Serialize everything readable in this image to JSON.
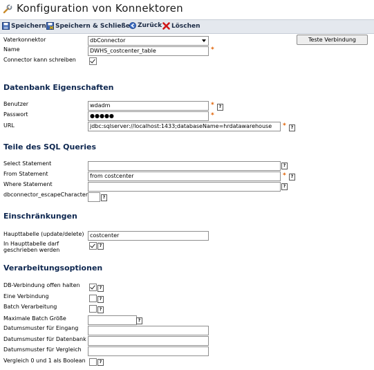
{
  "title": "Konfiguration von Konnektoren",
  "toolbar": {
    "save": "Speichern",
    "save_close": "Speichern & Schließen",
    "back": "Zurück",
    "delete": "Löschen"
  },
  "required_marker": "*",
  "help_glyph": "?",
  "general": {
    "parent_label": "Vaterkonnektor",
    "parent_value": "dbConnector",
    "name_label": "Name",
    "name_value": "DWHS_costcenter_table",
    "can_write_label": "Connector kann schreiben",
    "can_write_checked": true,
    "test_button": "Teste Verbindung"
  },
  "db": {
    "heading": "Datenbank Eigenschaften",
    "user_label": "Benutzer",
    "user_value": "wdadm",
    "password_label": "Passwort",
    "password_value": "●●●●●",
    "url_label": "URL",
    "url_value": "jdbc:sqlserver://localhost:1433;databaseName=hrdatawarehouse"
  },
  "sql": {
    "heading": "Teile des SQL Queries",
    "select_label": "Select Statement",
    "select_value": "",
    "from_label": "From Statement",
    "from_value": "from costcenter",
    "where_label": "Where Statement",
    "where_value": "",
    "escape_label": "dbconnector_escapeCharacter",
    "escape_value": ""
  },
  "restrictions": {
    "heading": "Einschränkungen",
    "main_table_label": "Haupttabelle (update/delete)",
    "main_table_value": "costcenter",
    "write_label_1": "In Haupttabelle darf",
    "write_label_2": "geschrieben werden",
    "write_checked": true
  },
  "processing": {
    "heading": "Verarbeitungsoptionen",
    "keep_open_label": "DB-Verbindung offen halten",
    "keep_open_checked": true,
    "single_label": "Eine Verbindung",
    "single_checked": false,
    "batch_label": "Batch Verarbeitung",
    "batch_checked": false,
    "max_batch_label": "Maximale Batch Größe",
    "max_batch_value": "",
    "date_in_label": "Datumsmuster für Eingang",
    "date_in_value": "",
    "date_db_label": "Datumsmuster für Datenbank",
    "date_db_value": "",
    "date_cmp_label": "Datumsmuster für Vergleich",
    "date_cmp_value": "",
    "bool_label": "Vergleich 0 und 1 als Boolean",
    "bool_checked": false
  }
}
